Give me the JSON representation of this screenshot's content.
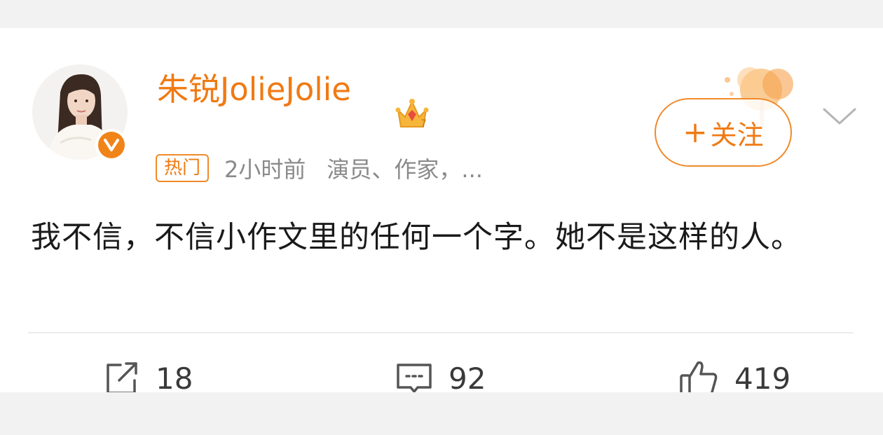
{
  "post": {
    "username": "朱锐JolieJolie",
    "hot_tag": "热门",
    "time": "2小时前",
    "description": "演员、作家，...",
    "text": "我不信，不信小作文里的任何一个字。她不是这样的人。",
    "follow_label": "关注"
  },
  "actions": {
    "share_count": "18",
    "comment_count": "92",
    "like_count": "419"
  },
  "icons": {
    "verified": "verified-v-icon",
    "crown": "crown-level-icon",
    "more": "chevron-down-icon",
    "share": "share-icon",
    "comment": "comment-icon",
    "like": "thumbs-up-icon"
  },
  "colors": {
    "accent": "#f07a13",
    "text": "#1a1a1a",
    "muted": "#8a8a8a"
  }
}
